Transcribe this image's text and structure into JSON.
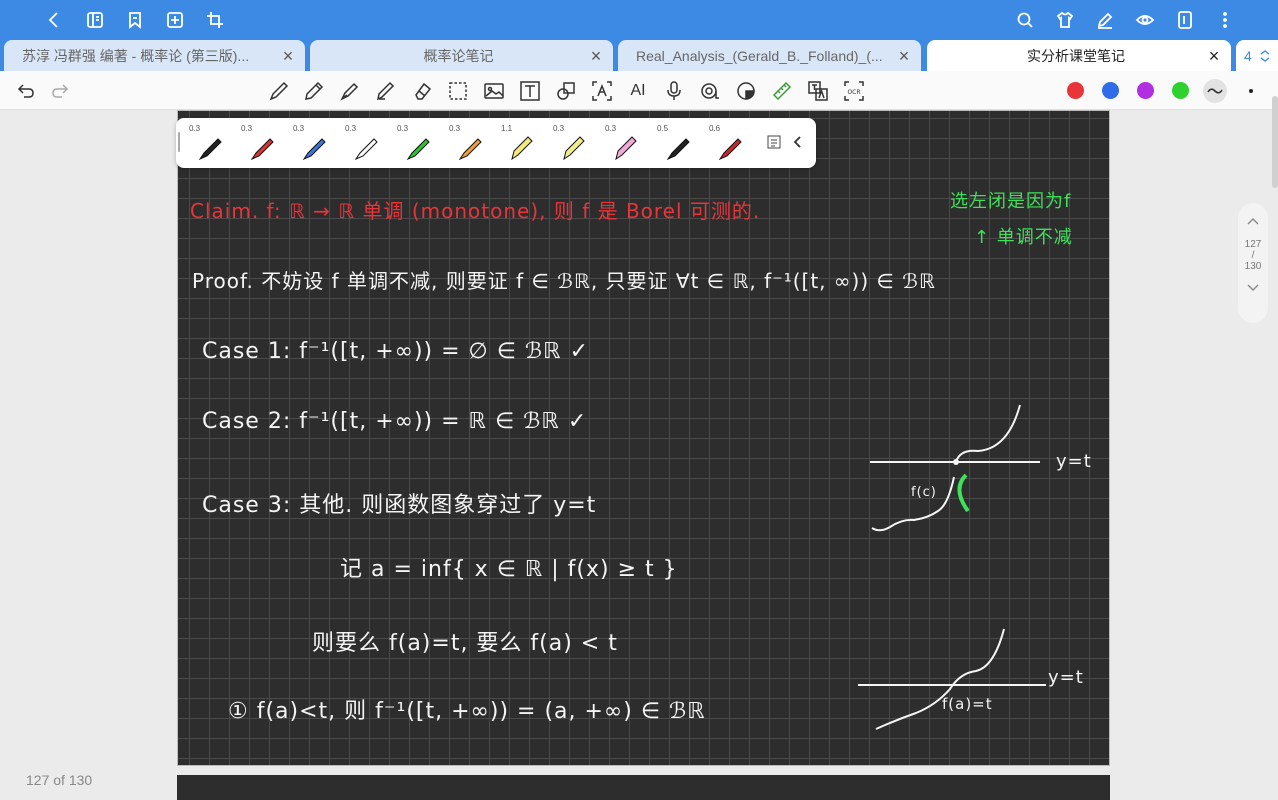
{
  "tabs": [
    {
      "label": "苏淳 冯群强 编著 - 概率论 (第三版)..."
    },
    {
      "label": "概率论笔记"
    },
    {
      "label": "Real_Analysis_(Gerald_B._Folland)_(..."
    },
    {
      "label": "实分析课堂笔记"
    }
  ],
  "tab_count": "4",
  "colors": {
    "accent": "#3d8ae5",
    "red": "#e8353a",
    "blue": "#2f6de8",
    "purple": "#b12fe0",
    "green": "#2fd12f"
  },
  "pens": [
    {
      "size": "0.3",
      "color": "#222222",
      "icon": "black-pen-icon"
    },
    {
      "size": "0.3",
      "color": "#d93434",
      "icon": "red-pen-icon"
    },
    {
      "size": "0.3",
      "color": "#3a78d8",
      "icon": "blue-pen-icon"
    },
    {
      "size": "0.3",
      "color": "#ffffff",
      "icon": "white-pen-icon"
    },
    {
      "size": "0.3",
      "color": "#2fc22f",
      "icon": "green-pen-icon"
    },
    {
      "size": "0.3",
      "color": "#f0a030",
      "icon": "orange-pen-icon"
    },
    {
      "size": "1.1",
      "color": "#f3e87a",
      "icon": "yellow-highlighter-icon"
    },
    {
      "size": "0.3",
      "color": "#f3ec8a",
      "icon": "yellow-highlighter-icon"
    },
    {
      "size": "0.3",
      "color": "#f2a9d8",
      "icon": "pink-highlighter-icon"
    },
    {
      "size": "0.5",
      "color": "#222222",
      "icon": "black-pen-icon"
    },
    {
      "size": "0.6",
      "color": "#c8282d",
      "icon": "red-pen-icon"
    }
  ],
  "toolbar": {
    "ai_label": "AI",
    "ocr_label": "OCR"
  },
  "notes": {
    "claim": "Claim.    f: ℝ → ℝ 单调 (monotone),  则 f 是 Borel 可测的.",
    "green_note_1": "选左闭是因为f",
    "green_note_2": "↑ 单调不减",
    "proof": "Proof. 不妨设 f 单调不减,  则要证 f ∈ ℬℝ,  只要证 ∀t ∈ ℝ,  f⁻¹([t, ∞)) ∈ ℬℝ",
    "case1": "Case 1:    f⁻¹([t, +∞)) = ∅ ∈ ℬℝ    ✓",
    "case2": "Case 2:    f⁻¹([t, +∞)) = ℝ ∈ ℬℝ    ✓",
    "case3": "Case 3:    其他.  则函数图象穿过了 y=t",
    "define_a": "记   a = inf{ x ∈ ℝ |  f(x) ≥ t }",
    "either": "则要么 f(a)=t,  要么 f(a) < t",
    "item1": "① f(a)<t,   则   f⁻¹([t, +∞)) = (a, +∞) ∈ ℬℝ",
    "graph1_label_y": "y=t",
    "graph1_label_f": "f(c)",
    "graph2_label_y": "y=t",
    "graph2_label_f": "f(a)=t"
  },
  "scroller": {
    "current": "127",
    "sep": "/",
    "total": "130"
  },
  "page_count": "127 of 130"
}
